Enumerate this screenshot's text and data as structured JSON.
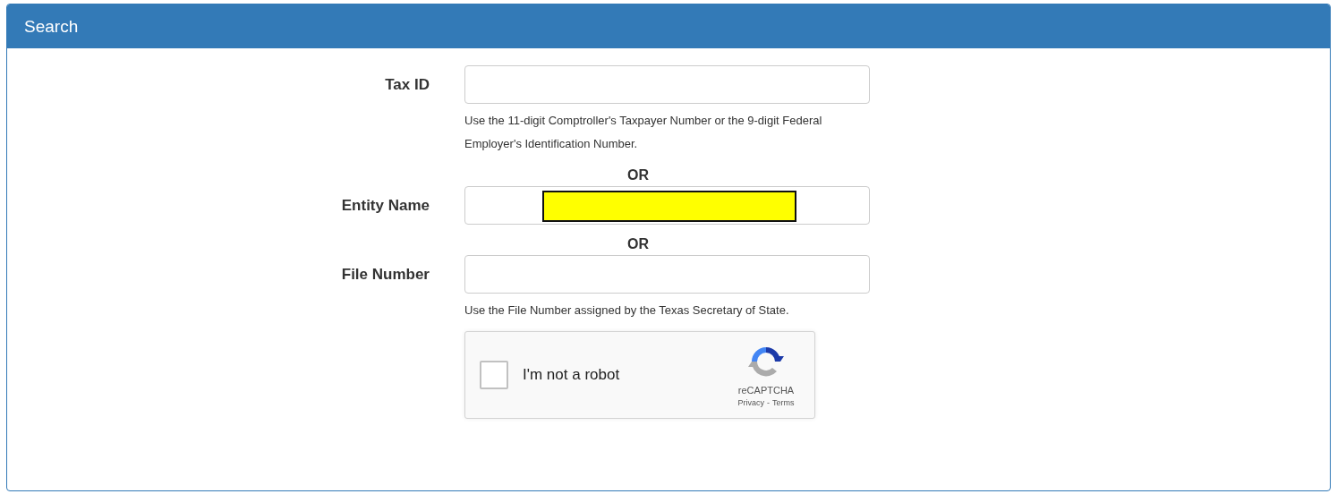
{
  "panel": {
    "title": "Search"
  },
  "rows": [
    {
      "kind": "field",
      "label": "Tax ID",
      "value_redacted": false,
      "help": "Use the 11-digit Comptroller's Taxpayer Number or the 9-digit Federal Employer's Identification Number."
    },
    {
      "kind": "separator",
      "text": "OR"
    },
    {
      "kind": "field",
      "label": "Entity Name",
      "value_redacted": true
    },
    {
      "kind": "separator",
      "text": "OR"
    },
    {
      "kind": "field",
      "label": "File Number",
      "value_redacted": false,
      "help": "Use the File Number assigned by the Texas Secretary of State."
    }
  ],
  "captcha": {
    "checked": false,
    "label": "I'm not a robot",
    "brand": "reCAPTCHA",
    "links": [
      "Privacy",
      "Terms"
    ],
    "link_separator": "-"
  }
}
